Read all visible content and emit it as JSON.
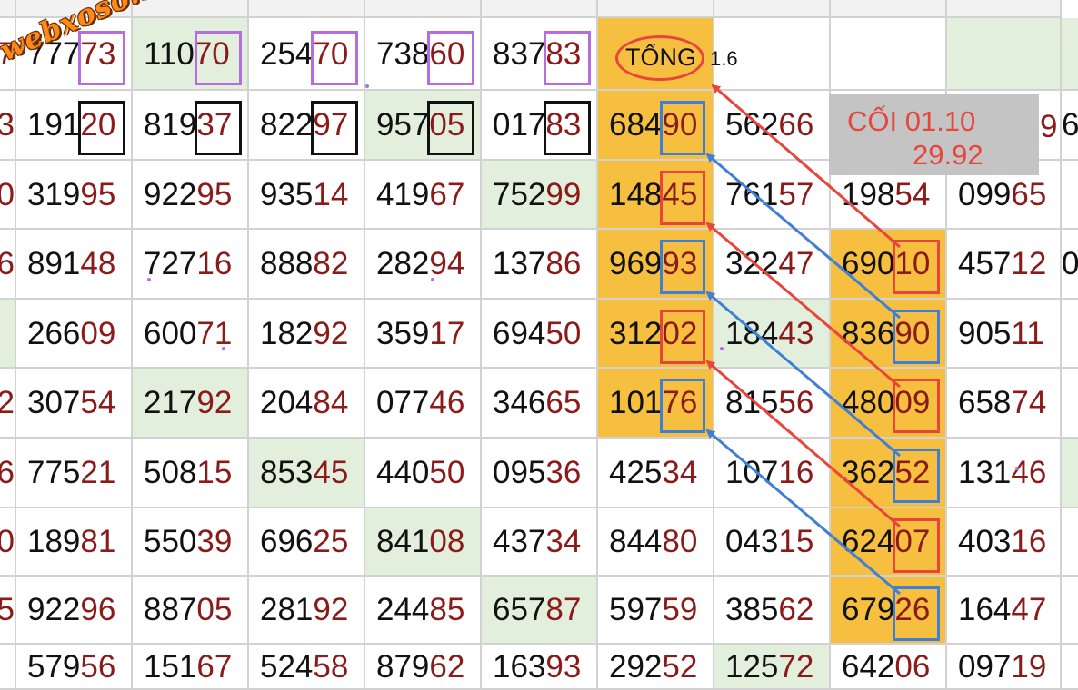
{
  "rows": [
    [
      "77773",
      "11070",
      "25470",
      "73860",
      "83783",
      "",
      "",
      "",
      ""
    ],
    [
      "19120",
      "81937",
      "82297",
      "95705",
      "01783",
      "68490",
      "56266",
      "",
      ""
    ],
    [
      "31995",
      "92295",
      "93514",
      "41967",
      "75299",
      "14845",
      "76157",
      "19854",
      "09965"
    ],
    [
      "89148",
      "72716",
      "88882",
      "28294",
      "13786",
      "96993",
      "32247",
      "69010",
      "45712"
    ],
    [
      "26609",
      "60071",
      "18292",
      "35917",
      "69450",
      "31202",
      "18443",
      "83690",
      "90511"
    ],
    [
      "30754",
      "21792",
      "20484",
      "07746",
      "34665",
      "10176",
      "81556",
      "48009",
      "65874"
    ],
    [
      "77521",
      "50815",
      "85345",
      "44050",
      "09536",
      "42534",
      "10716",
      "36252",
      "13146"
    ],
    [
      "18981",
      "55039",
      "69625",
      "84108",
      "43734",
      "84480",
      "04315",
      "62407",
      "40316"
    ],
    [
      "92296",
      "88705",
      "28192",
      "24485",
      "65787",
      "59759",
      "38562",
      "67926",
      "16447"
    ],
    [
      "57956",
      "15167",
      "52458",
      "87962",
      "16393",
      "29252",
      "12572",
      "64206",
      "09719"
    ]
  ],
  "left_fragments": [
    "7",
    "3",
    "0",
    "6",
    "",
    "2",
    "6",
    "0",
    "5",
    ""
  ],
  "right_fragments": [
    "",
    "6",
    "",
    "0",
    "",
    "",
    "",
    "",
    "",
    ""
  ],
  "partial_cells": {
    "row1_col8_tail": "9"
  },
  "tong": {
    "label": "TỔNG",
    "value": "1.6"
  },
  "coi": {
    "line1": "CỐI 01.10",
    "line2": "29.92"
  },
  "watermark": "webxoso.net",
  "colors": {
    "tail_digits": "#8b1a1a",
    "highlight_orange": "#f6bf3f",
    "highlight_green": "#e2efdc",
    "box_purple": "#b56ddf",
    "box_black": "#111111",
    "box_red": "#e8453c",
    "box_blue": "#3f7fd8",
    "annotation_gray": "#c4c4c4"
  }
}
